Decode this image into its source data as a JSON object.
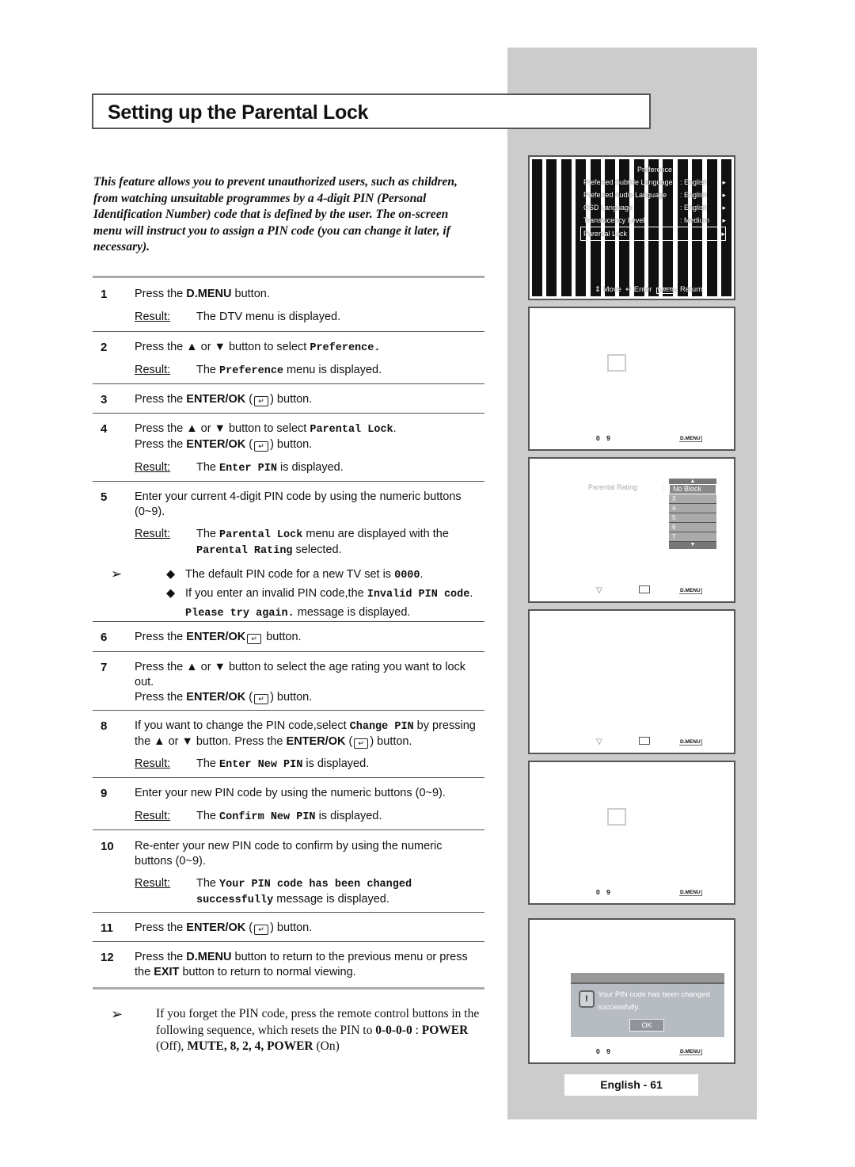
{
  "page": {
    "title": "Setting up the Parental Lock",
    "intro": "This feature allows you to prevent unauthorized users, such as children, from watching unsuitable programmes by a 4-digit PIN (Personal Identification Number) code that is defined by the user. The on-screen menu will instruct you to assign a PIN code (you can change it later, if necessary).",
    "page_number": "English - 61"
  },
  "labels": {
    "result": "Result:"
  },
  "steps": [
    {
      "num": "1",
      "text_pre": "Press the ",
      "bold": "D.MENU",
      "text_post": " button.",
      "result": "The DTV menu is displayed."
    },
    {
      "num": "2",
      "text_pre": "Press the ▲ or ▼ button to select ",
      "mono": "Preference.",
      "result_pre": "The ",
      "result_mono": "Preference",
      "result_post": " menu is displayed."
    },
    {
      "num": "3",
      "text_pre": "Press the ",
      "bold": "ENTER/OK",
      "text_post": " button."
    },
    {
      "num": "4",
      "text_pre": "Press the ▲ or ▼ button to select ",
      "mono": "Parental Lock",
      "text_post": ".",
      "line2_pre": "Press the ",
      "line2_bold": "ENTER/OK",
      "line2_post": " button.",
      "result_pre": "The ",
      "result_mono": "Enter PIN",
      "result_post": " is displayed."
    },
    {
      "num": "5",
      "text": "Enter your current 4-digit PIN code by using the numeric buttons (0~9).",
      "result_pre": "The ",
      "result_mono": "Parental Lock",
      "result_mid": " menu are displayed with the ",
      "result_mono2": "Parental Rating",
      "result_post": " selected."
    },
    {
      "num": "6",
      "text_pre": "Press the ",
      "bold": "ENTER/OK",
      "text_post": " button."
    },
    {
      "num": "7",
      "text": "Press the ▲ or ▼ button to select the age rating you want to lock out.",
      "line2_pre": "Press the ",
      "line2_bold": "ENTER/OK",
      "line2_post": " button."
    },
    {
      "num": "8",
      "text_pre": "If you want to change the PIN code,select ",
      "mono": "Change PIN",
      "text_post": " by pressing the ▲ or ▼ button. Press the ",
      "bold": "ENTER/OK",
      "text_post2": " button.",
      "result_pre": "The ",
      "result_mono": "Enter New PIN",
      "result_post": " is displayed."
    },
    {
      "num": "9",
      "text": "Enter your new PIN code by using the numeric buttons (0~9).",
      "result_pre": "The ",
      "result_mono": "Confirm New PIN",
      "result_post": " is displayed."
    },
    {
      "num": "10",
      "text": "Re-enter your new PIN code to confirm by using the numeric buttons (0~9).",
      "result_pre": "The ",
      "result_mono": "Your PIN code has been changed successfully",
      "result_post": " message is displayed."
    },
    {
      "num": "11",
      "text_pre": "Press the ",
      "bold": "ENTER/OK",
      "text_post": " button."
    },
    {
      "num": "12",
      "text_pre": "Press the ",
      "bold": "D.MENU",
      "text_mid": " button to return to the previous menu or press the ",
      "bold2": "EXIT",
      "text_post": " button to return to normal viewing."
    }
  ],
  "note": {
    "arrow": "➢",
    "bullet": "◆",
    "line1_pre": "The default PIN code for a new TV set is ",
    "line1_mono": "0000",
    "line1_post": ".",
    "line2_pre": "If you enter an invalid PIN code,the ",
    "line2_mono": "Invalid PIN code",
    "line2_post": ".",
    "line3_mono": "Please try again.",
    "line3_post": " message is displayed."
  },
  "bottom_note": {
    "arrow": "➢",
    "text": "If you forget the PIN code, press the remote control buttons in the following sequence, which resets the PIN to ",
    "seq_bold1": "0-0-0-0",
    "sep": " : ",
    "power": "POWER",
    "off": " (Off), ",
    "mute": "MUTE, 8, 2, 4, ",
    "power2": "POWER",
    "on": " (On)"
  },
  "screens": {
    "preference": {
      "title": "Preference",
      "rows": [
        {
          "label": "Preferred Subtitle Language",
          "value": ": English"
        },
        {
          "label": "Preferred Audio Language",
          "value": ": English"
        },
        {
          "label": "OSD Language",
          "value": ": English"
        },
        {
          "label": "Translucency Level",
          "value": ": Medium"
        },
        {
          "label": "Parental Lock",
          "value": ""
        }
      ],
      "nav_move": "Move",
      "nav_enter": "Enter",
      "nav_return": "Return"
    },
    "pin_hint": "0  9",
    "dmenu": "D.MENU",
    "parental_rating": {
      "label": "Parental Rating",
      "colon": ":",
      "options": [
        "No Block",
        "3",
        "4",
        "5",
        "6",
        "7"
      ],
      "selected": "No Block"
    },
    "success_dialog": {
      "message": "Your PIN code has been changed successfully.",
      "ok": "OK",
      "icon": "!"
    }
  }
}
